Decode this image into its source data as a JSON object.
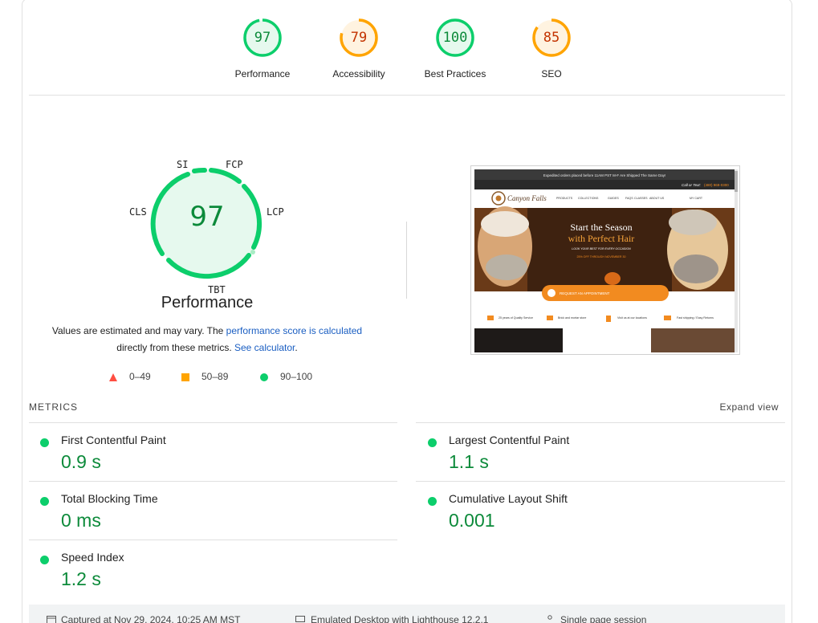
{
  "colors": {
    "pass": "#0cce6b",
    "pass_text": "#0c8a3a",
    "average": "#ffa400",
    "average_text": "#c33300",
    "fail": "#ff4e42",
    "link": "#1a5ec2"
  },
  "gauges": [
    {
      "label": "Performance",
      "score": "97",
      "value": 97,
      "status": "pass"
    },
    {
      "label": "Accessibility",
      "score": "79",
      "value": 79,
      "status": "average"
    },
    {
      "label": "Best Practices",
      "score": "100",
      "value": 100,
      "status": "pass"
    },
    {
      "label": "SEO",
      "score": "85",
      "value": 85,
      "status": "average"
    }
  ],
  "performance": {
    "score": "97",
    "title": "Performance",
    "metric_tags": {
      "si": "SI",
      "fcp": "FCP",
      "lcp": "LCP",
      "tbt": "TBT",
      "cls": "CLS"
    },
    "desc_part1": "Values are estimated and may vary. The ",
    "desc_link1": "performance score is calculated",
    "desc_part2": "directly from these metrics. ",
    "desc_link2": "See calculator",
    "desc_part3": "."
  },
  "legend": [
    {
      "range": "0–49",
      "shape": "triangle",
      "color": "#ff4e42"
    },
    {
      "range": "50–89",
      "shape": "square",
      "color": "#ffa400"
    },
    {
      "range": "90–100",
      "shape": "circle",
      "color": "#0cce6b"
    }
  ],
  "screenshot": {
    "topbar": "Expedited orders placed before 11AM PST M-F Are Shipped The Same Day!",
    "call": "Call or Text:",
    "phone": "(480) 969-0300",
    "brand": "Canyon Falls",
    "nav": [
      "PRODUCTS",
      "COLLECTIONS",
      "GUIDES",
      "FAQS",
      "CLASSES",
      "ABOUT US"
    ],
    "cart": "MY CART",
    "hero_line1": "Start the Season",
    "hero_line2": "with Perfect Hair",
    "hero_sub": "LOOK YOUR BEST FOR EVERY OCCASION",
    "hero_promo": "25% OFF THROUGH NOVEMBER 30",
    "cta": "REQUEST AN APPOINTMENT",
    "features": [
      "25 years of Quality Service",
      "Brick and mortar store",
      "Visit us at our locations",
      "Fast shipping / Easy Returns"
    ]
  },
  "metrics": {
    "heading": "METRICS",
    "expand": "Expand view",
    "items": [
      {
        "name": "First Contentful Paint",
        "value": "0.9 s"
      },
      {
        "name": "Largest Contentful Paint",
        "value": "1.1 s"
      },
      {
        "name": "Total Blocking Time",
        "value": "0 ms"
      },
      {
        "name": "Cumulative Layout Shift",
        "value": "0.001"
      },
      {
        "name": "Speed Index",
        "value": "1.2 s"
      }
    ]
  },
  "footer": {
    "captured": "Captured at Nov 29, 2024, 10:25 AM MST",
    "emulated": "Emulated Desktop with Lighthouse 12.2.1",
    "session": "Single page session"
  }
}
